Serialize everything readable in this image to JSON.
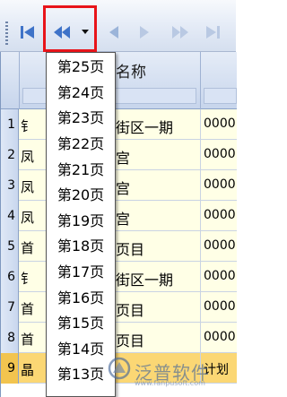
{
  "toolbar": {
    "buttons": [
      "first-page",
      "previous-group",
      "dropdown",
      "previous-page",
      "next-page",
      "next-group",
      "last-page"
    ]
  },
  "grid": {
    "header_name": "名称",
    "rows": [
      {
        "num": "1",
        "c1": "钅",
        "c2": "街区一期",
        "c3": "0000"
      },
      {
        "num": "2",
        "c1": "凤",
        "c2": "宫",
        "c3": "0000"
      },
      {
        "num": "3",
        "c1": "凤",
        "c2": "宫",
        "c3": "0000"
      },
      {
        "num": "4",
        "c1": "凤",
        "c2": "宫",
        "c3": "0000"
      },
      {
        "num": "5",
        "c1": "首",
        "c2": "页目",
        "c3": "0000"
      },
      {
        "num": "6",
        "c1": "钅",
        "c2": "街区一期",
        "c3": "0000"
      },
      {
        "num": "7",
        "c1": "首",
        "c2": "页目",
        "c3": "0000"
      },
      {
        "num": "8",
        "c1": "首",
        "c2": "页目",
        "c3": "0000"
      },
      {
        "num": "9",
        "c1": "晶",
        "c2": "",
        "c3": "计划"
      }
    ]
  },
  "page_menu": {
    "items": [
      "第25页",
      "第24页",
      "第23页",
      "第22页",
      "第21页",
      "第20页",
      "第19页",
      "第18页",
      "第17页",
      "第16页",
      "第15页",
      "第14页",
      "第13页"
    ]
  },
  "watermark": {
    "text": "泛普软件",
    "url": "www.fanpusoft.com"
  },
  "colors": {
    "highlight": "#e8141a",
    "row_bg": "#ffffe6",
    "selected_row": "#fbd774",
    "icon_blue": "#3f73c8"
  }
}
